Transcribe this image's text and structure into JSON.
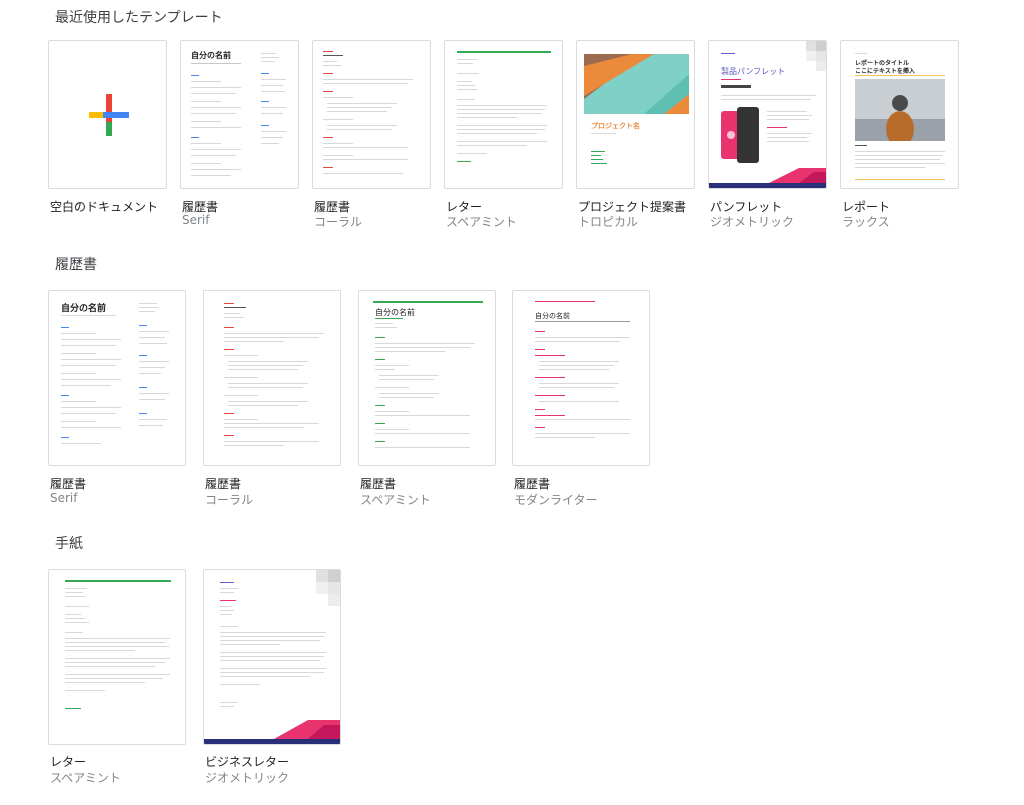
{
  "sections": {
    "recent": "最近使用したテンプレート",
    "resume": "履歴書",
    "letter": "手紙"
  },
  "recent": [
    {
      "title": "空白のドキュメント",
      "subtitle": ""
    },
    {
      "title": "履歴書",
      "subtitle": "Serif"
    },
    {
      "title": "履歴書",
      "subtitle": "コーラル"
    },
    {
      "title": "レター",
      "subtitle": "スペアミント"
    },
    {
      "title": "プロジェクト提案書",
      "subtitle": "トロピカル"
    },
    {
      "title": "パンフレット",
      "subtitle": "ジオメトリック"
    },
    {
      "title": "レポート",
      "subtitle": "ラックス"
    }
  ],
  "resume": [
    {
      "title": "履歴書",
      "subtitle": "Serif"
    },
    {
      "title": "履歴書",
      "subtitle": "コーラル"
    },
    {
      "title": "履歴書",
      "subtitle": "スペアミント"
    },
    {
      "title": "履歴書",
      "subtitle": "モダンライター"
    }
  ],
  "letter": [
    {
      "title": "レター",
      "subtitle": "スペアミント"
    },
    {
      "title": "ビジネスレター",
      "subtitle": "ジオメトリック"
    }
  ],
  "thumbnails": {
    "resume_name": "自分の名前",
    "project_name": "プロジェクト名",
    "brochure_title": "製品パンフレット",
    "report_title": "レポートのタイトル",
    "report_subtitle": "ここにテキストを挿入"
  },
  "colors": {
    "coral": "#e8453c",
    "spearmint": "#34a853",
    "tropical_teal": "#7fd1c7",
    "tropical_orange": "#ec8a3b",
    "geometric_pink": "#e8336f",
    "geometric_navy": "#2a2f7a",
    "plus_red": "#ea4335",
    "plus_blue": "#4285f4",
    "plus_yellow": "#fbbc04",
    "plus_green": "#34a853"
  }
}
